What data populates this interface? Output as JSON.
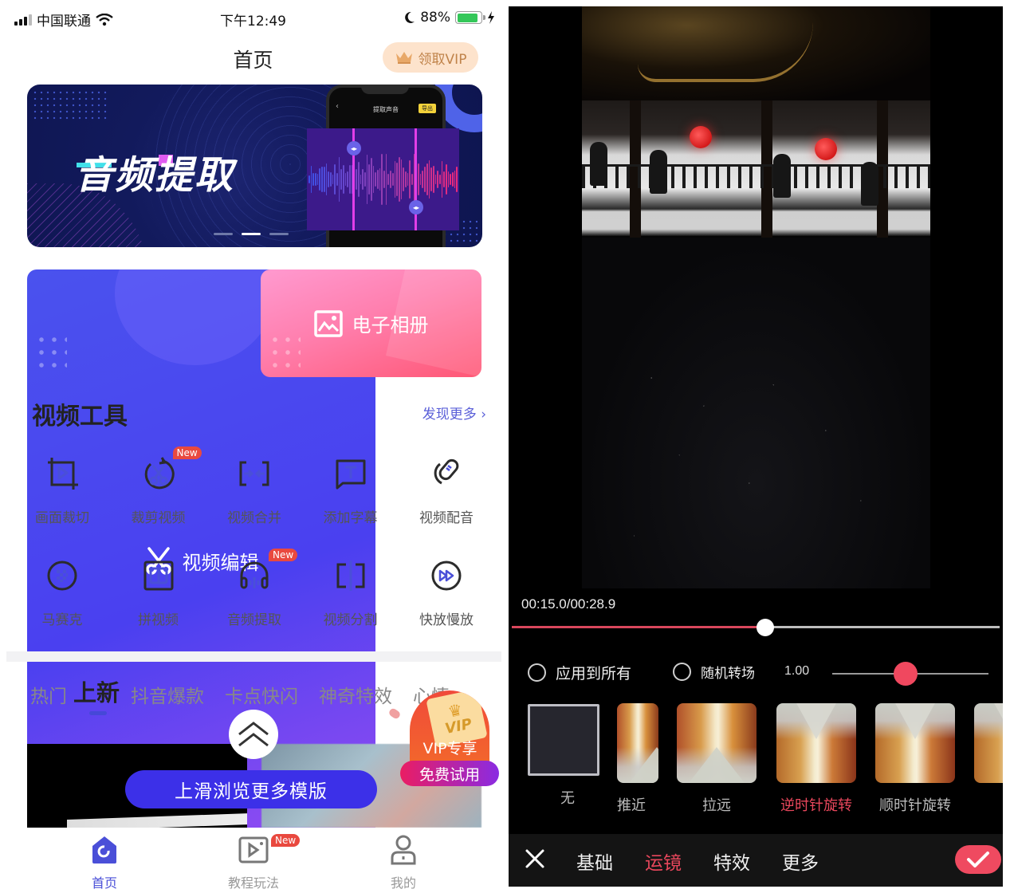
{
  "left_screen": {
    "status_bar": {
      "carrier": "中国联通",
      "time": "下午12:49",
      "battery_percent": "88%",
      "battery_level": 0.88,
      "icons": [
        "signal-icon",
        "wifi-icon",
        "moon-icon",
        "battery-icon",
        "charging-icon"
      ]
    },
    "nav": {
      "title": "首页",
      "vip_button": "领取VIP",
      "vip_icon": "crown-icon"
    },
    "banner": {
      "title": "音频提取",
      "phone_title": "提取声音",
      "phone_button": "导出",
      "page_count": 3,
      "active_page": 2,
      "colors": {
        "background": "#121a5c",
        "wave_box": "#3c1a8a",
        "marker": "#e23ee8"
      }
    },
    "feature_cards": [
      {
        "label": "视频编辑",
        "icon": "scissors-icon",
        "color": "#4a40f0"
      },
      {
        "label": "电子相册",
        "icon": "image-icon",
        "color": "#ff5775"
      }
    ],
    "video_tools": {
      "title": "视频工具",
      "more_link": "发现更多",
      "items": [
        {
          "label": "画面裁切",
          "icon": "crop-icon",
          "badge": ""
        },
        {
          "label": "裁剪视频",
          "icon": "cut-video-icon",
          "badge": "New"
        },
        {
          "label": "视频合并",
          "icon": "merge-icon",
          "badge": ""
        },
        {
          "label": "添加字幕",
          "icon": "subtitle-icon",
          "badge": ""
        },
        {
          "label": "视频配音",
          "icon": "microphone-icon",
          "badge": ""
        },
        {
          "label": "马赛克",
          "icon": "mosaic-icon",
          "badge": ""
        },
        {
          "label": "拼视频",
          "icon": "split-screen-icon",
          "badge": ""
        },
        {
          "label": "音频提取",
          "icon": "headphones-icon",
          "badge": "New"
        },
        {
          "label": "视频分割",
          "icon": "split-icon",
          "badge": ""
        },
        {
          "label": "快放慢放",
          "icon": "fast-forward-icon",
          "badge": ""
        }
      ]
    },
    "category_tabs": [
      {
        "label": "热门",
        "active": false
      },
      {
        "label": "上新",
        "active": true
      },
      {
        "label": "抖音爆款",
        "active": false
      },
      {
        "label": "卡点快闪",
        "active": false
      },
      {
        "label": "神奇特效",
        "active": false
      },
      {
        "label": "心情",
        "active": false
      }
    ],
    "swipe_hint": "上滑浏览更多模版",
    "vip_promo": {
      "card_text": "VIP",
      "title": "VIP专享",
      "button": "免费试用"
    },
    "tab_bar": [
      {
        "label": "首页",
        "icon": "home-icon",
        "active": true,
        "badge": ""
      },
      {
        "label": "教程玩法",
        "icon": "tutorial-video-icon",
        "active": false,
        "badge": "New"
      },
      {
        "label": "我的",
        "icon": "profile-icon",
        "active": false,
        "badge": ""
      }
    ],
    "colors": {
      "accent": "#4a4fd8",
      "badge": "#e9493f",
      "vip_text": "#c0834a"
    }
  },
  "right_screen": {
    "playback": {
      "time_readout": "00:15.0/00:28.9",
      "current_seconds": 15.0,
      "total_seconds": 28.9
    },
    "options": {
      "apply_all": {
        "label": "应用到所有",
        "checked": false
      },
      "random_transition": {
        "label": "随机转场",
        "checked": false
      },
      "speed_value": "1.00",
      "speed_fraction": 0.47
    },
    "effects": [
      {
        "label": "无",
        "selected": false,
        "type": "none"
      },
      {
        "label": "推近",
        "selected": false,
        "type": "alley"
      },
      {
        "label": "拉远",
        "selected": false,
        "type": "alley"
      },
      {
        "label": "逆时针旋转",
        "selected": true,
        "type": "alley-rot"
      },
      {
        "label": "顺时针旋转",
        "selected": false,
        "type": "alley-rot"
      }
    ],
    "bottom_tabs": [
      {
        "label": "基础",
        "active": false
      },
      {
        "label": "运镜",
        "active": true
      },
      {
        "label": "特效",
        "active": false
      },
      {
        "label": "更多",
        "active": false
      }
    ],
    "colors": {
      "accent": "#e8475c",
      "progress": "#d9475c"
    }
  }
}
